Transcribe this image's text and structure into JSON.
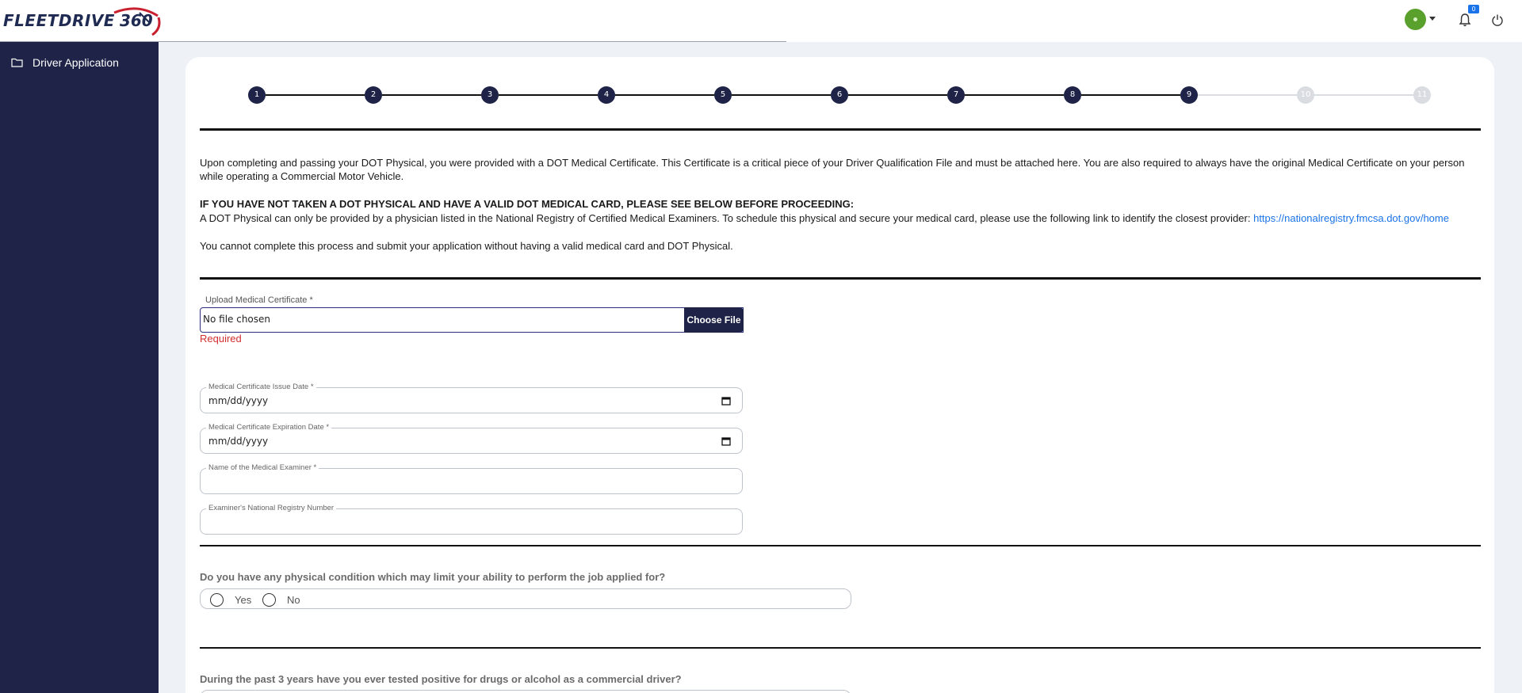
{
  "header": {
    "logo_text": "FLEETDRIVE",
    "logo_number": "360",
    "notification_count": "0"
  },
  "sidebar": {
    "items": [
      {
        "label": "Driver Application",
        "icon": "folder-icon"
      }
    ]
  },
  "stepper": {
    "steps": [
      "1",
      "2",
      "3",
      "4",
      "5",
      "6",
      "7",
      "8",
      "9",
      "10",
      "11"
    ],
    "current": 9,
    "active_color": "#1e2347",
    "inactive_color": "#d9dce1"
  },
  "intro": {
    "p1": "Upon completing and passing your DOT Physical, you were provided with a DOT Medical Certificate. This Certificate is a critical piece of your Driver Qualification File and must be attached here. You are also required to always have the original Medical Certificate on your person while operating a Commercial Motor Vehicle.",
    "warning_heading": "IF YOU HAVE NOT TAKEN A DOT PHYSICAL AND HAVE A VALID DOT MEDICAL CARD, PLEASE SEE BELOW BEFORE PROCEEDING:",
    "p2": "A DOT Physical can only be provided by a physician listed in the National Registry of Certified Medical Examiners. To schedule this physical and secure your medical card, please use the following link to identify the closest provider: ",
    "link": "https://nationalregistry.fmcsa.dot.gov/home",
    "p3": "You cannot complete this process and submit your application without having a valid medical card and DOT Physical."
  },
  "form": {
    "upload_label": "Upload Medical Certificate *",
    "upload_value": "No file chosen",
    "choose_file": "Choose File",
    "required_msg": "Required",
    "issue_date_label": "Medical Certificate Issue Date *",
    "issue_date_value": "mm/dd/yyyy",
    "expiration_date_label": "Medical Certificate Expiration Date *",
    "expiration_date_value": "mm/dd/yyyy",
    "examiner_name_label": "Name of the Medical Examiner *",
    "registry_number_label": "Examiner's National Registry Number"
  },
  "questions": {
    "q1": "Do you have any physical condition which may limit your ability to perform the job applied for?",
    "yes": "Yes",
    "no": "No",
    "q2": "During the past 3 years have you ever tested positive for drugs or alcohol as a commercial driver?"
  }
}
